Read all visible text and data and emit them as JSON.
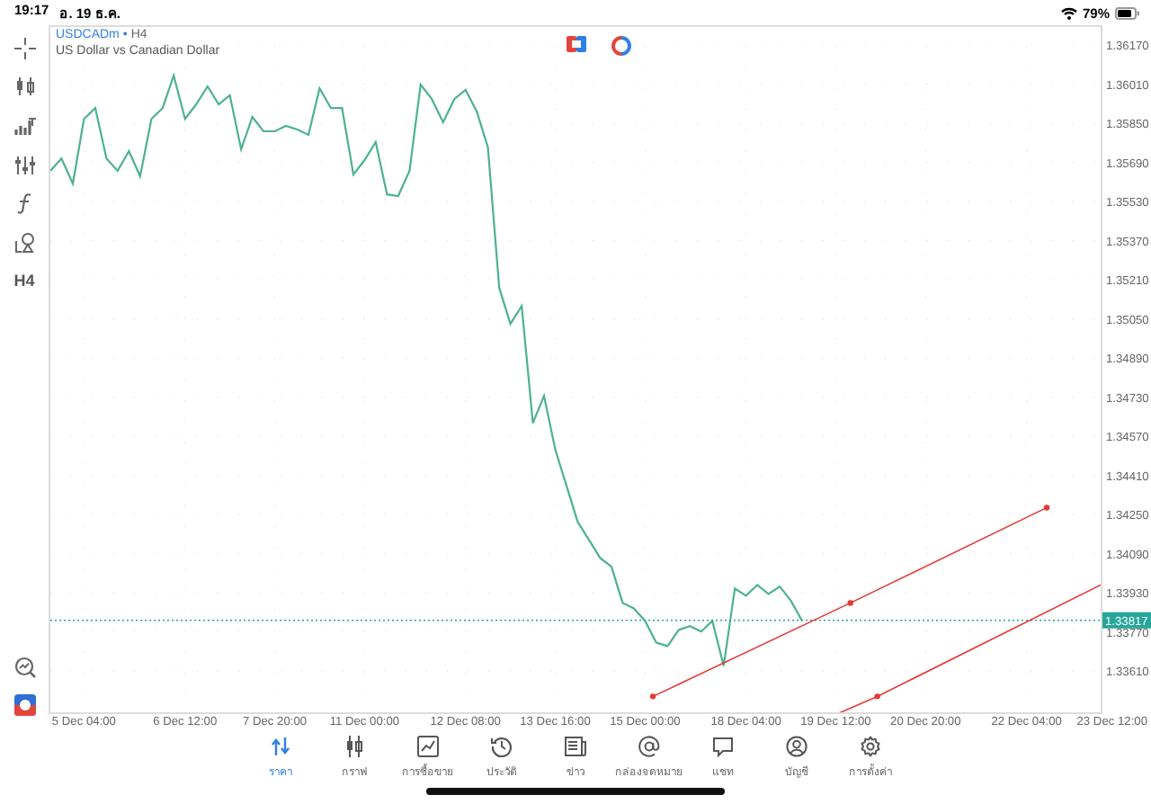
{
  "status_bar": {
    "time": "19:17",
    "date": "อ. 19 ธ.ค.",
    "battery": "79%"
  },
  "toolbar": {
    "timeframe": "H4"
  },
  "chart": {
    "separator": "•",
    "timeframe": "H4",
    "description": "US Dollar vs Canadian Dollar",
    "chart_data": {
      "type": "line",
      "grid": true,
      "ylim": [
        1.33441,
        1.36251
      ],
      "categories": [
        null,
        null,
        null,
        "5 Dec 04:00",
        null,
        null,
        null,
        null,
        null,
        null,
        null,
        null,
        "6 Dec 12:00",
        null,
        null,
        null,
        null,
        null,
        null,
        null,
        "7 Dec 20:00",
        null,
        null,
        null,
        null,
        null,
        null,
        null,
        "11 Dec 00:00",
        null,
        null,
        null,
        null,
        null,
        null,
        null,
        null,
        "12 Dec 08:00",
        null,
        null,
        null,
        null,
        null,
        null,
        null,
        "13 Dec 16:00",
        null,
        null,
        null,
        null,
        null,
        null,
        null,
        "15 Dec 00:00",
        null,
        null,
        null,
        null,
        null,
        null,
        null,
        null,
        "18 Dec 04:00",
        null,
        null,
        null,
        null,
        null,
        null,
        null,
        "19 Dec 12:00",
        null,
        null,
        null,
        null,
        null,
        null,
        null,
        "20 Dec 20:00",
        null,
        null,
        null,
        null,
        null,
        null,
        null,
        null,
        "22 Dec 04:00",
        null,
        null,
        null,
        null,
        null,
        null,
        null,
        "23 Dec 12:00"
      ],
      "series": [
        {
          "name": "USDCADm",
          "color": "#4db38a",
          "values": [
            1.35655,
            1.35706,
            1.35603,
            1.35868,
            1.35912,
            1.35706,
            1.35655,
            1.35736,
            1.35633,
            1.35868,
            1.35912,
            1.36045,
            1.35868,
            1.35927,
            1.36001,
            1.35927,
            1.35964,
            1.35743,
            1.35876,
            1.35817,
            1.35817,
            1.35839,
            1.35824,
            1.35802,
            1.35993,
            1.35912,
            1.35912,
            1.3564,
            1.35699,
            1.35773,
            1.35559,
            1.35552,
            1.35655,
            1.36008,
            1.35949,
            1.35854,
            1.35949,
            1.35986,
            1.35898,
            1.35751,
            1.35176,
            1.35029,
            1.35103,
            1.34624,
            1.34735,
            1.34514,
            1.34367,
            1.3422,
            1.34146,
            1.34072,
            1.34036,
            1.33888,
            1.33866,
            1.33815,
            1.33726,
            1.33712,
            1.33778,
            1.33793,
            1.33771,
            1.33815,
            1.33631,
            1.33947,
            1.33918,
            1.33962,
            1.33925,
            1.33955,
            1.33896,
            1.33815,
            null,
            null,
            null,
            null,
            null,
            null,
            null,
            null,
            null,
            null,
            null,
            null,
            null,
            null,
            null,
            null,
            null,
            null,
            null,
            null,
            null,
            null,
            null,
            null,
            null,
            null,
            null,
            null
          ]
        }
      ],
      "yticks": [
        {
          "value": 1.3617,
          "label": "1.36170"
        },
        {
          "value": 1.3601,
          "label": "1.36010"
        },
        {
          "value": 1.3585,
          "label": "1.35850"
        },
        {
          "value": 1.3569,
          "label": "1.35690"
        },
        {
          "value": 1.3553,
          "label": "1.35530"
        },
        {
          "value": 1.3537,
          "label": "1.35370"
        },
        {
          "value": 1.3521,
          "label": "1.35210"
        },
        {
          "value": 1.3505,
          "label": "1.35050"
        },
        {
          "value": 1.3489,
          "label": "1.34890"
        },
        {
          "value": 1.3473,
          "label": "1.34730"
        },
        {
          "value": 1.3457,
          "label": "1.34570"
        },
        {
          "value": 1.3441,
          "label": "1.34410"
        },
        {
          "value": 1.3425,
          "label": "1.34250"
        },
        {
          "value": 1.3409,
          "label": "1.34090"
        },
        {
          "value": 1.3393,
          "label": "1.33930"
        },
        {
          "value": 1.3377,
          "label": "1.33770"
        },
        {
          "value": 1.3361,
          "label": "1.33610"
        }
      ],
      "ref_lines": [
        {
          "axis": "y",
          "value": 1.33817,
          "label": "1.33817",
          "color": "#26a69a"
        }
      ]
    }
  },
  "tabs": [
    {
      "label": "ราคา",
      "selected": true
    },
    {
      "label": "กราฟ",
      "selected": false
    },
    {
      "label": "การซื้อขาย",
      "selected": false
    },
    {
      "label": "ประวัติ",
      "selected": false
    },
    {
      "label": "ข่าว",
      "selected": false
    },
    {
      "label": "กล่องจดหมาย",
      "selected": false
    },
    {
      "label": "แชท",
      "selected": false
    },
    {
      "label": "บัญชี",
      "selected": false
    },
    {
      "label": "การตั้งค่า",
      "selected": false
    }
  ]
}
